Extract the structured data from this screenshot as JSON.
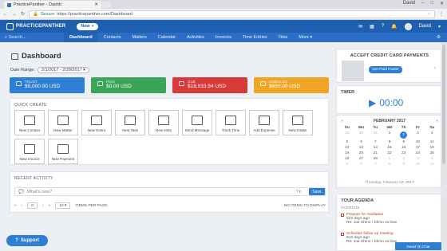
{
  "browser": {
    "tab_title": "PracticePanther - Dashb",
    "secure_label": "Secure",
    "url": "https://practicepanther.com/Dashboard",
    "user": "David"
  },
  "app": {
    "logo_text": "PRACTICEPANTHER",
    "new_button": "New",
    "accent": "#1f5fb0"
  },
  "nav": {
    "search_placeholder": "Search...",
    "items": [
      "Dashboard",
      "Contacts",
      "Matters",
      "Calendar",
      "Activities",
      "Invoices",
      "Time Entries",
      "Files",
      "More"
    ],
    "active": "Dashboard"
  },
  "dashboard": {
    "title": "Dashboard",
    "date_range_label": "Date Range:",
    "date_range_value": "2/1/2017 - 2/28/2017",
    "cards": [
      {
        "label": "TRUST",
        "amount": "$5,000.00 USD",
        "color": "#2d7fd4"
      },
      {
        "label": "PAID",
        "amount": "$0.00 USD",
        "color": "#3aa457"
      },
      {
        "label": "DUE",
        "amount": "$18,933.94 USD",
        "color": "#d83a3a"
      },
      {
        "label": "UNBILLED",
        "amount": "$650.00 USD",
        "color": "#f0a624"
      }
    ],
    "quick_create_title": "QUICK CREATE",
    "quick_create": [
      {
        "label": "New Contact",
        "icon": "contact-icon"
      },
      {
        "label": "New Matter",
        "icon": "briefcase-icon"
      },
      {
        "label": "New Event",
        "icon": "calendar-icon"
      },
      {
        "label": "New Task",
        "icon": "task-icon"
      },
      {
        "label": "New Note",
        "icon": "note-icon"
      },
      {
        "label": "Send Message",
        "icon": "envelope-icon"
      },
      {
        "label": "Track Time",
        "icon": "clock-icon"
      },
      {
        "label": "Add Expense",
        "icon": "money-bag-icon"
      },
      {
        "label": "New Intake",
        "icon": "intake-icon"
      },
      {
        "label": "New Invoice",
        "icon": "invoice-icon"
      },
      {
        "label": "New Payment",
        "icon": "payment-icon"
      }
    ],
    "recent_activity_title": "RECENT ACTIVITY",
    "whats_new_placeholder": "What's new?",
    "save_button": "Save",
    "pager_page": "0",
    "pager_size": "10",
    "items_per_page": "ITEMS PER PAGE",
    "no_items": "NO ITEMS TO DISPLAY",
    "support_button": "Support"
  },
  "sidebar": {
    "cc_title": "ACCEPT CREDIT CARD PAYMENTS",
    "cc_button": "Get Paid Faster",
    "timer_title": "TIMER",
    "timer_value": "00:00",
    "calendar": {
      "month": "FEBRUARY 2017",
      "days": [
        "Su",
        "Mo",
        "Tu",
        "We",
        "Th",
        "Fr",
        "Sa"
      ],
      "weeks": [
        [
          "29",
          "30",
          "31",
          "1",
          "2",
          "3",
          "4"
        ],
        [
          "5",
          "6",
          "7",
          "8",
          "9",
          "10",
          "11"
        ],
        [
          "12",
          "13",
          "14",
          "15",
          "16",
          "17",
          "18"
        ],
        [
          "19",
          "20",
          "21",
          "22",
          "23",
          "24",
          "25"
        ],
        [
          "26",
          "27",
          "28",
          "1",
          "2",
          "3",
          "4"
        ],
        [
          "5",
          "6",
          "7",
          "8",
          "9",
          "10",
          "11"
        ]
      ],
      "today": "2",
      "footer": "Thursday, February 02, 2017"
    },
    "agenda_title": "YOUR AGENDA",
    "agenda_sub": "OVERDUE",
    "agenda_items": [
      {
        "title": "Prepare for mediation",
        "ago": "622 days ago",
        "re": "Re: Joe Shmo / Shmo vs Doe"
      },
      {
        "title": "Schedule follow up meeting",
        "ago": "616 days ago",
        "re": "Re: Joe Shmo / Shmo vs Doe"
      }
    ],
    "chat_label": "David (0) Chat"
  }
}
